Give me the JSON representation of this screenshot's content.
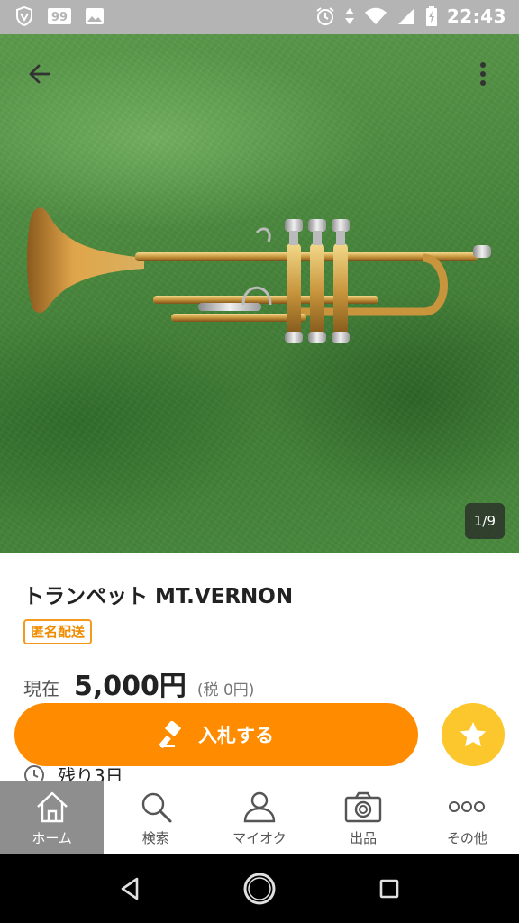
{
  "status_bar": {
    "time": "22:43",
    "left_icons": [
      "shield-icon",
      "badge-99-icon",
      "image-icon"
    ],
    "right_icons": [
      "alarm-icon",
      "data-arrows-icon",
      "wifi-icon",
      "signal-icon",
      "battery-charging-icon"
    ]
  },
  "hero": {
    "page_indicator": "1/9"
  },
  "item": {
    "title": "トランペット MT.VERNON",
    "badge": "匿名配送",
    "price_label": "現在",
    "price": "5,000円",
    "tax": "(税 0円)",
    "remaining": "残り3日"
  },
  "actions": {
    "bid_label": "入札する"
  },
  "bottom_nav": {
    "items": [
      {
        "label": "ホーム",
        "icon": "home-icon",
        "active": true
      },
      {
        "label": "検索",
        "icon": "search-icon",
        "active": false
      },
      {
        "label": "マイオク",
        "icon": "person-icon",
        "active": false
      },
      {
        "label": "出品",
        "icon": "camera-icon",
        "active": false
      },
      {
        "label": "その他",
        "icon": "more-dots-icon",
        "active": false
      }
    ]
  },
  "colors": {
    "accent": "#ff8c00",
    "watch": "#fcc72c",
    "badge": "#f59a1b",
    "status_bar": "#b4b4b4",
    "nav_active": "#8e8e8e"
  }
}
